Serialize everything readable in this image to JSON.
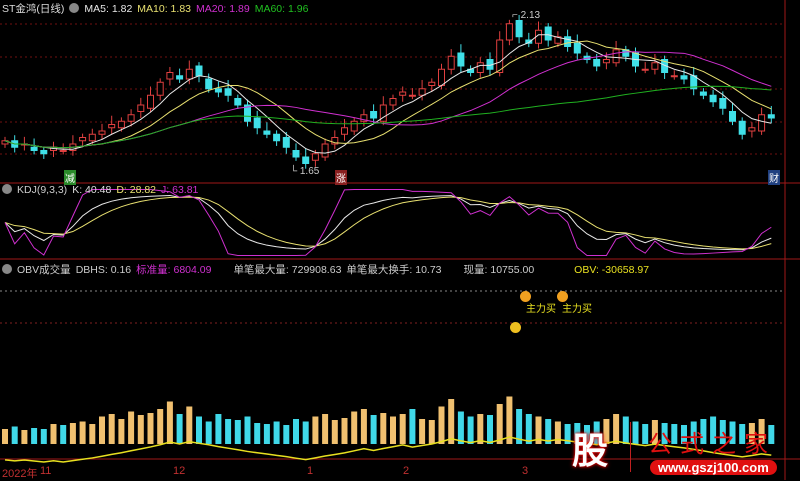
{
  "header": {
    "title": "ST金鸿(日线)",
    "ma5": "MA5: 1.82",
    "ma10": "MA10: 1.83",
    "ma20": "MA20: 1.89",
    "ma60": "MA60: 1.96"
  },
  "kdj": {
    "title": "KDJ(9,3,3)",
    "k": "K: 40.48",
    "d": "D: 28.82",
    "j": "J: 63.81"
  },
  "obv": {
    "title": "OBV成交量",
    "dbhs": "DBHS: 0.16",
    "std": "标准量: 6804.09",
    "max_vol": "单笔最大量: 729908.63",
    "max_turn": "单笔最大换手: 10.73",
    "cur": "现量: 10755.00",
    "obv": "OBV: -30658.97"
  },
  "annotations": {
    "high": "2.13",
    "low": "1.65",
    "tag_jian": "减",
    "tag_zhang": "涨",
    "tag_cai": "财",
    "buy1": "主力买",
    "buy2": "主力买"
  },
  "xaxis": {
    "year": "2022年",
    "m11": "11",
    "m12": "12",
    "m1": "1",
    "m2": "2",
    "m3": "3"
  },
  "logo": {
    "char": "股",
    "name": "公式之家",
    "url": "www.gszj100.com"
  },
  "colors": {
    "up": "#e04040",
    "down": "#40e0e8",
    "ma5": "#e8e8e8",
    "ma10": "#e8e070",
    "ma20": "#d030d0",
    "ma60": "#20b020"
  },
  "chart_data": {
    "type": "candlestick",
    "closes": [
      1.74,
      1.72,
      1.73,
      1.71,
      1.7,
      1.72,
      1.71,
      1.73,
      1.75,
      1.76,
      1.77,
      1.79,
      1.8,
      1.82,
      1.85,
      1.88,
      1.92,
      1.95,
      1.93,
      1.96,
      1.94,
      1.9,
      1.89,
      1.88,
      1.85,
      1.8,
      1.78,
      1.76,
      1.74,
      1.72,
      1.69,
      1.67,
      1.7,
      1.73,
      1.75,
      1.78,
      1.8,
      1.82,
      1.81,
      1.85,
      1.87,
      1.89,
      1.88,
      1.9,
      1.92,
      1.96,
      2.0,
      1.97,
      1.95,
      1.98,
      1.96,
      2.05,
      2.1,
      2.06,
      2.04,
      2.08,
      2.05,
      2.06,
      2.03,
      2.01,
      1.99,
      1.97,
      1.99,
      2.02,
      2.0,
      1.97,
      1.96,
      1.98,
      1.95,
      1.94,
      1.93,
      1.9,
      1.88,
      1.86,
      1.84,
      1.8,
      1.76,
      1.78,
      1.82,
      1.81
    ],
    "volumes": [
      30,
      35,
      28,
      32,
      30,
      40,
      38,
      42,
      45,
      40,
      55,
      60,
      50,
      65,
      58,
      62,
      70,
      85,
      60,
      75,
      55,
      45,
      60,
      50,
      48,
      55,
      42,
      40,
      45,
      38,
      50,
      45,
      55,
      60,
      48,
      52,
      65,
      70,
      58,
      62,
      55,
      60,
      70,
      50,
      48,
      75,
      90,
      65,
      55,
      60,
      58,
      80,
      95,
      70,
      60,
      55,
      50,
      45,
      40,
      42,
      38,
      45,
      50,
      60,
      55,
      45,
      40,
      48,
      42,
      40,
      38,
      45,
      50,
      55,
      48,
      45,
      40,
      42,
      50,
      38
    ],
    "ylim": [
      1.6,
      2.16
    ]
  }
}
